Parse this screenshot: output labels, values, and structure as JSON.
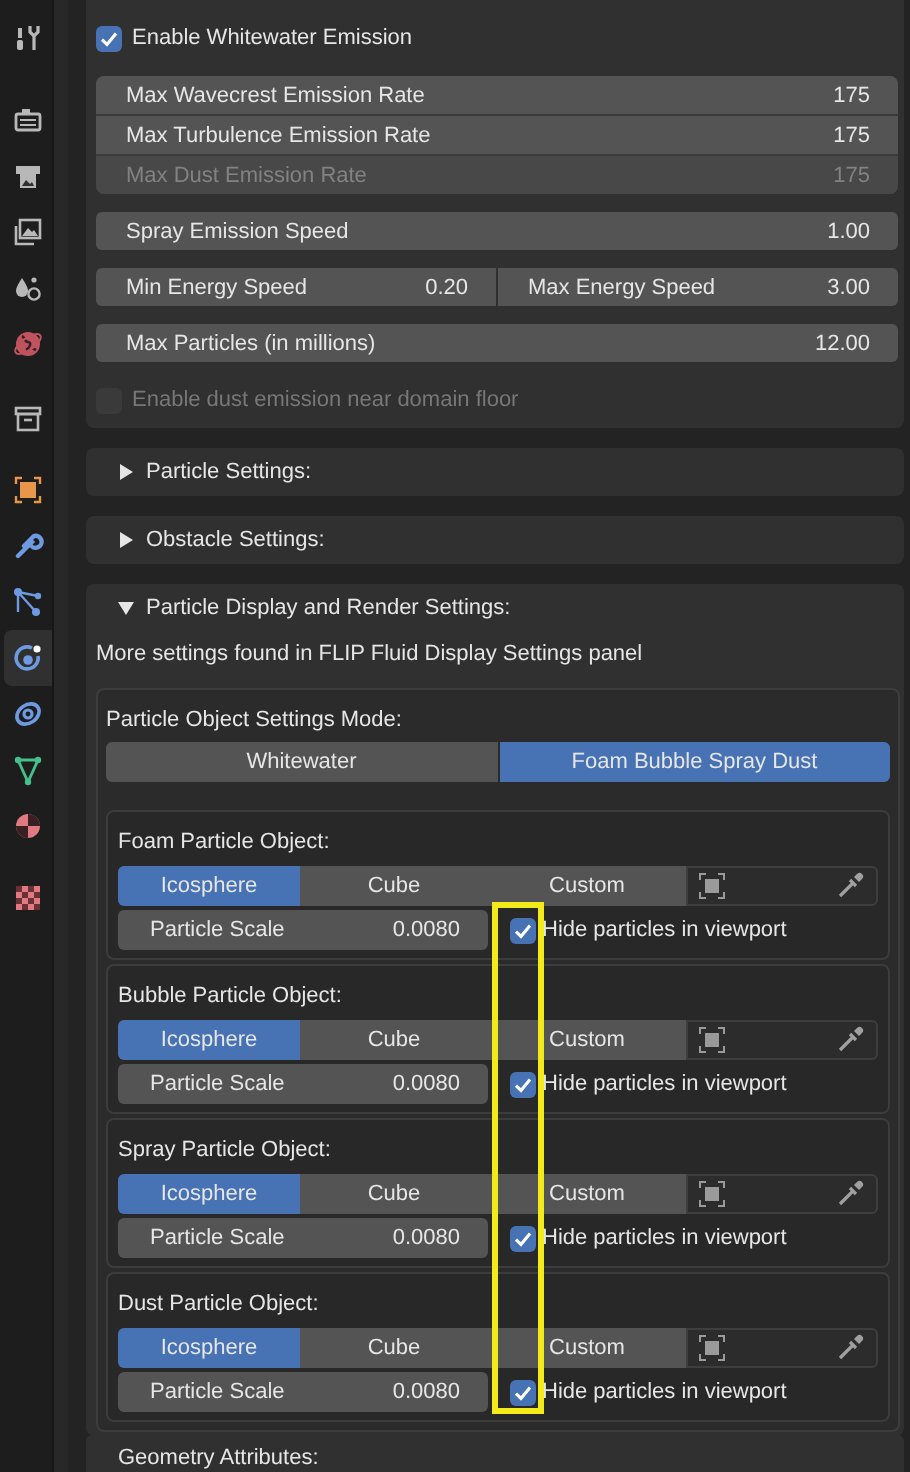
{
  "sidebar": {
    "tabs": [
      {
        "kind": "tool",
        "selected": false
      },
      {
        "kind": "render",
        "selected": false
      },
      {
        "kind": "output",
        "selected": false
      },
      {
        "kind": "view_layer",
        "selected": false
      },
      {
        "kind": "scene",
        "selected": false
      },
      {
        "kind": "world",
        "selected": false
      },
      {
        "kind": "collection",
        "selected": false
      },
      {
        "kind": "object",
        "selected": false
      },
      {
        "kind": "modifier",
        "selected": false
      },
      {
        "kind": "particles",
        "selected": false
      },
      {
        "kind": "physics",
        "selected": true
      },
      {
        "kind": "constraints",
        "selected": false
      },
      {
        "kind": "data",
        "selected": false
      },
      {
        "kind": "material",
        "selected": false
      },
      {
        "kind": "texture",
        "selected": false
      }
    ]
  },
  "whitewater": {
    "enable": {
      "label": "Enable Whitewater Emission",
      "checked": true
    },
    "emission_rates": [
      {
        "label": "Max Wavecrest Emission Rate",
        "value": "175",
        "disabled": false
      },
      {
        "label": "Max Turbulence Emission Rate",
        "value": "175",
        "disabled": false
      },
      {
        "label": "Max Dust Emission Rate",
        "value": "175",
        "disabled": true
      }
    ],
    "spray_speed": {
      "label": "Spray Emission Speed",
      "value": "1.00"
    },
    "energy": [
      {
        "label": "Min Energy Speed",
        "value": "0.20"
      },
      {
        "label": "Max Energy Speed",
        "value": "3.00"
      }
    ],
    "max_particles": {
      "label": "Max Particles (in millions)",
      "value": "12.00"
    },
    "dust_floor": {
      "label": "Enable dust emission near domain floor",
      "checked": false,
      "disabled": true
    }
  },
  "panels": [
    {
      "title": "Particle Settings:",
      "expanded": false
    },
    {
      "title": "Obstacle Settings:",
      "expanded": false
    },
    {
      "title": "Particle Display and Render Settings:",
      "expanded": true,
      "note": "More settings found in FLIP Fluid Display Settings panel",
      "mode": {
        "label": "Particle Object Settings Mode:",
        "options": [
          {
            "label": "Whitewater",
            "selected": false
          },
          {
            "label": "Foam Bubble Spray Dust",
            "selected": true
          }
        ]
      },
      "objects": [
        {
          "title": "Foam Particle Object:",
          "shapes": [
            {
              "label": "Icosphere",
              "selected": true
            },
            {
              "label": "Cube",
              "selected": false
            },
            {
              "label": "Custom",
              "selected": false
            }
          ],
          "scale": {
            "label": "Particle Scale",
            "value": "0.0080"
          },
          "hide": {
            "label": "Hide particles in viewport",
            "checked": true
          }
        },
        {
          "title": "Bubble Particle Object:",
          "shapes": [
            {
              "label": "Icosphere",
              "selected": true
            },
            {
              "label": "Cube",
              "selected": false
            },
            {
              "label": "Custom",
              "selected": false
            }
          ],
          "scale": {
            "label": "Particle Scale",
            "value": "0.0080"
          },
          "hide": {
            "label": "Hide particles in viewport",
            "checked": true
          }
        },
        {
          "title": "Spray Particle Object:",
          "shapes": [
            {
              "label": "Icosphere",
              "selected": true
            },
            {
              "label": "Cube",
              "selected": false
            },
            {
              "label": "Custom",
              "selected": false
            }
          ],
          "scale": {
            "label": "Particle Scale",
            "value": "0.0080"
          },
          "hide": {
            "label": "Hide particles in viewport",
            "checked": true
          }
        },
        {
          "title": "Dust Particle Object:",
          "shapes": [
            {
              "label": "Icosphere",
              "selected": true
            },
            {
              "label": "Cube",
              "selected": false
            },
            {
              "label": "Custom",
              "selected": false
            }
          ],
          "scale": {
            "label": "Particle Scale",
            "value": "0.0080"
          },
          "hide": {
            "label": "Hide particles in viewport",
            "checked": true
          }
        }
      ]
    },
    {
      "title": "Geometry Attributes:"
    }
  ],
  "highlight": {
    "shown": true
  }
}
